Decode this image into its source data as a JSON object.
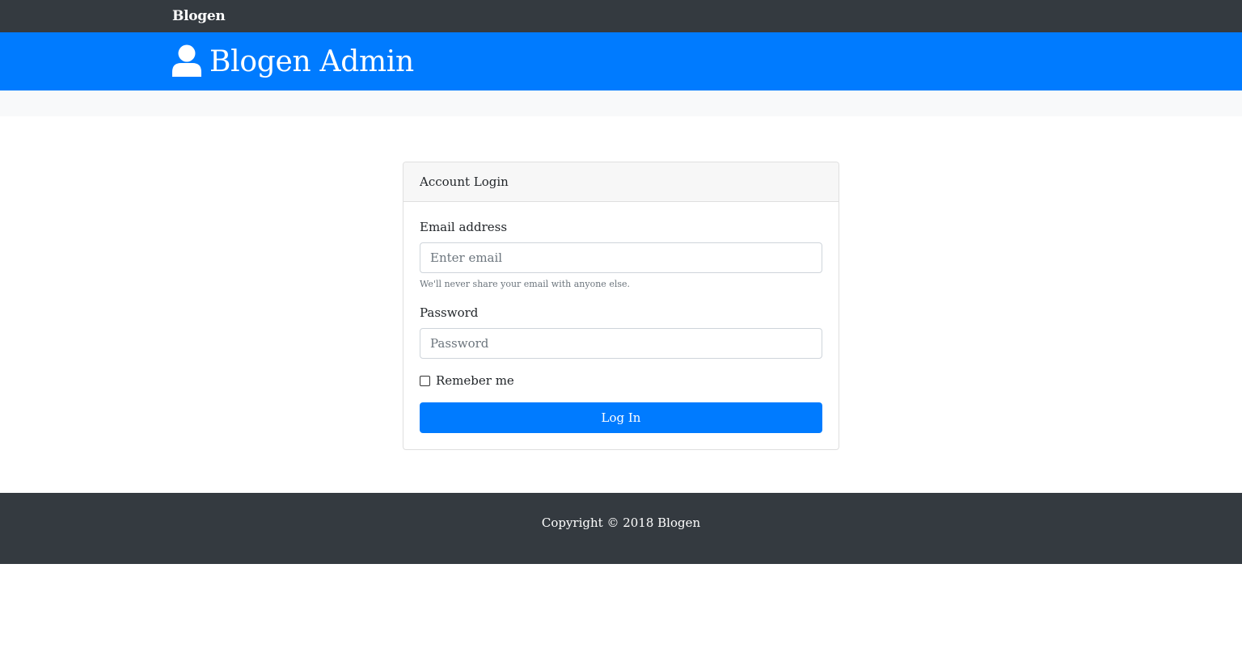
{
  "navbar": {
    "brand": "Blogen"
  },
  "header": {
    "icon": "user-icon",
    "title": "Blogen Admin"
  },
  "login_card": {
    "title": "Account Login",
    "email": {
      "label": "Email address",
      "placeholder": "Enter email",
      "value": "",
      "help": "We'll never share your email with anyone else."
    },
    "password": {
      "label": "Password",
      "placeholder": "Password",
      "value": ""
    },
    "remember": {
      "label": "Remeber me",
      "checked": false
    },
    "submit_label": "Log In"
  },
  "footer": {
    "copyright": "Copyright © 2018 Blogen"
  },
  "colors": {
    "navbar_bg": "#343a40",
    "header_bg": "#007bff",
    "primary": "#007bff",
    "strip_bg": "#f8f9fa",
    "footer_bg": "#343a40"
  }
}
